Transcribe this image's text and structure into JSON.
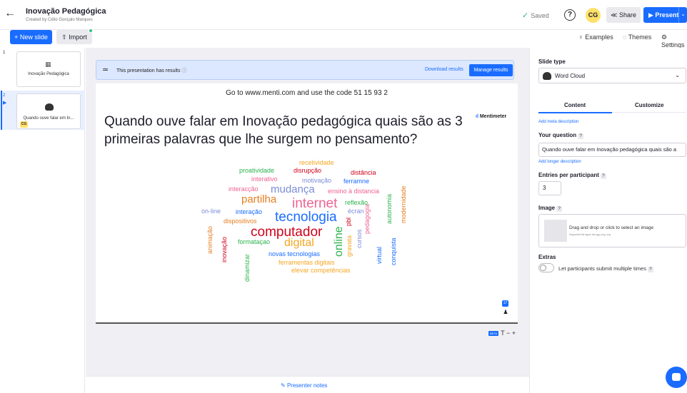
{
  "header": {
    "back_icon": "arrow-left-icon",
    "title": "Inovação Pedagógica",
    "subtitle": "Created by Célio Gonçalo Marques",
    "saved": "Saved",
    "help": "?",
    "avatar_initials": "CG",
    "share": "Share",
    "present": "Present"
  },
  "toolbar": {
    "new_slide": "+ New slide",
    "import": "Import",
    "examples": "Examples",
    "themes": "Themes",
    "settings": "Settings"
  },
  "slides": [
    {
      "number": "1",
      "label": "Inovação Pedagógica"
    },
    {
      "number": "2",
      "label": "Quando ouve falar em In...",
      "badge": "CG"
    }
  ],
  "banner": {
    "text": "This presentation has results",
    "download": "Download results",
    "manage": "Manage results"
  },
  "slide": {
    "instructions": "Go to www.menti.com and use the code 51 15 93 2",
    "question": "Quando ouve falar em Inovação pedagógica quais são as 3 primeiras palavras que lhe surgem no pensamento?",
    "brand": "Mentimeter",
    "responses": "17",
    "beta": "BETA",
    "zoom_controls": "T − +"
  },
  "wordcloud": [
    {
      "text": "recetividade",
      "color": "#f5a623"
    },
    {
      "text": "proatividade",
      "color": "#2bb24c"
    },
    {
      "text": "disrupção",
      "color": "#d0021b"
    },
    {
      "text": "distância",
      "color": "#d0021b"
    },
    {
      "text": "interativo",
      "color": "#f06292"
    },
    {
      "text": "motivação",
      "color": "#7b8dd8"
    },
    {
      "text": "ferramne",
      "color": "#196cff"
    },
    {
      "text": "interacção",
      "color": "#f06292"
    },
    {
      "text": "mudança",
      "color": "#7b8dd8"
    },
    {
      "text": "ensino à distancia",
      "color": "#f06292"
    },
    {
      "text": "partilha",
      "color": "#e67e22"
    },
    {
      "text": "internet",
      "color": "#f06292"
    },
    {
      "text": "reflexão",
      "color": "#2bb24c"
    },
    {
      "text": "on-line",
      "color": "#7b8dd8"
    },
    {
      "text": "interação",
      "color": "#196cff"
    },
    {
      "text": "écran",
      "color": "#7b8dd8"
    },
    {
      "text": "tecnologia",
      "color": "#196cff"
    },
    {
      "text": "dispositivos",
      "color": "#e67e22"
    },
    {
      "text": "computador",
      "color": "#d0021b"
    },
    {
      "text": "formataçao",
      "color": "#2bb24c"
    },
    {
      "text": "digital",
      "color": "#f5a623"
    },
    {
      "text": "novas tecnologias",
      "color": "#196cff"
    },
    {
      "text": "ferramentas digitais",
      "color": "#f5a623"
    },
    {
      "text": "elevar competências",
      "color": "#f5a623"
    },
    {
      "text": "animação",
      "color": "#e67e22"
    },
    {
      "text": "inovação",
      "color": "#d0021b"
    },
    {
      "text": "dinamizar",
      "color": "#2bb24c"
    },
    {
      "text": "online",
      "color": "#2bb24c"
    },
    {
      "text": "pbl",
      "color": "#d0021b"
    },
    {
      "text": "gravata",
      "color": "#f5a623"
    },
    {
      "text": "cursos",
      "color": "#7b8dd8"
    },
    {
      "text": "pedagogia",
      "color": "#f06292"
    },
    {
      "text": "virtual",
      "color": "#196cff"
    },
    {
      "text": "autonomia",
      "color": "#2bb24c"
    },
    {
      "text": "conquista",
      "color": "#196cff"
    },
    {
      "text": "modernidade",
      "color": "#e67e22"
    }
  ],
  "notes": "Presenter notes",
  "panel": {
    "slide_type_label": "Slide type",
    "slide_type": "Word Cloud",
    "tab_content": "Content",
    "tab_customize": "Customize",
    "add_meta": "Add meta description",
    "your_question_label": "Your question",
    "question_value": "Quando ouve falar em Inovação pedagógica quais são a",
    "add_longer": "Add longer description",
    "entries_label": "Entries per participant",
    "entries_value": "3",
    "image_label": "Image",
    "image_drop": "Drag and drop or click to select an image",
    "image_types": "Supported file types are jpg, png, svg",
    "extras_label": "Extras",
    "multiple_label": "Let participants submit multiple times",
    "help_mark": "?"
  },
  "colors": {
    "accent": "#196cff",
    "banner_bg": "#dce8ff",
    "avatar_bg": "#ffe16a"
  }
}
